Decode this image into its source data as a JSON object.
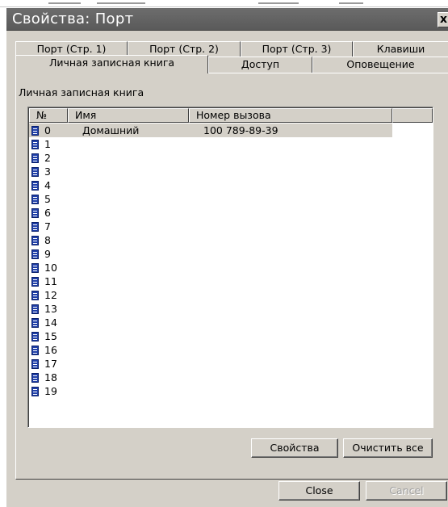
{
  "window": {
    "title": "Свойства: Порт",
    "close_label": "x"
  },
  "tabs": {
    "row1": [
      "Порт (Стр. 1)",
      "Порт (Стр. 2)",
      "Порт (Стр. 3)",
      "Клавиши"
    ],
    "row2": [
      "Личная записная книга",
      "Доступ",
      "Оповещение"
    ],
    "active": "Личная записная книга"
  },
  "panel": {
    "group_label": "Личная записная книга"
  },
  "list": {
    "columns": [
      "№",
      "Имя",
      "Номер вызова"
    ],
    "rows": [
      {
        "num": "0",
        "name": "Домашний",
        "phone": "100 789-89-39"
      },
      {
        "num": "1",
        "name": "",
        "phone": ""
      },
      {
        "num": "2",
        "name": "",
        "phone": ""
      },
      {
        "num": "3",
        "name": "",
        "phone": ""
      },
      {
        "num": "4",
        "name": "",
        "phone": ""
      },
      {
        "num": "5",
        "name": "",
        "phone": ""
      },
      {
        "num": "6",
        "name": "",
        "phone": ""
      },
      {
        "num": "7",
        "name": "",
        "phone": ""
      },
      {
        "num": "8",
        "name": "",
        "phone": ""
      },
      {
        "num": "9",
        "name": "",
        "phone": ""
      },
      {
        "num": "10",
        "name": "",
        "phone": ""
      },
      {
        "num": "11",
        "name": "",
        "phone": ""
      },
      {
        "num": "12",
        "name": "",
        "phone": ""
      },
      {
        "num": "13",
        "name": "",
        "phone": ""
      },
      {
        "num": "14",
        "name": "",
        "phone": ""
      },
      {
        "num": "15",
        "name": "",
        "phone": ""
      },
      {
        "num": "16",
        "name": "",
        "phone": ""
      },
      {
        "num": "17",
        "name": "",
        "phone": ""
      },
      {
        "num": "18",
        "name": "",
        "phone": ""
      },
      {
        "num": "19",
        "name": "",
        "phone": ""
      }
    ],
    "row_icon": "address-card-icon"
  },
  "buttons": {
    "properties": "Свойства",
    "clear_all": "Очистить все",
    "close": "Close",
    "cancel": "Cancel"
  },
  "colors": {
    "titlebar": "#5f5f5f",
    "dialog": "#d4d0c8",
    "row_icon": "#1f3fa8"
  }
}
